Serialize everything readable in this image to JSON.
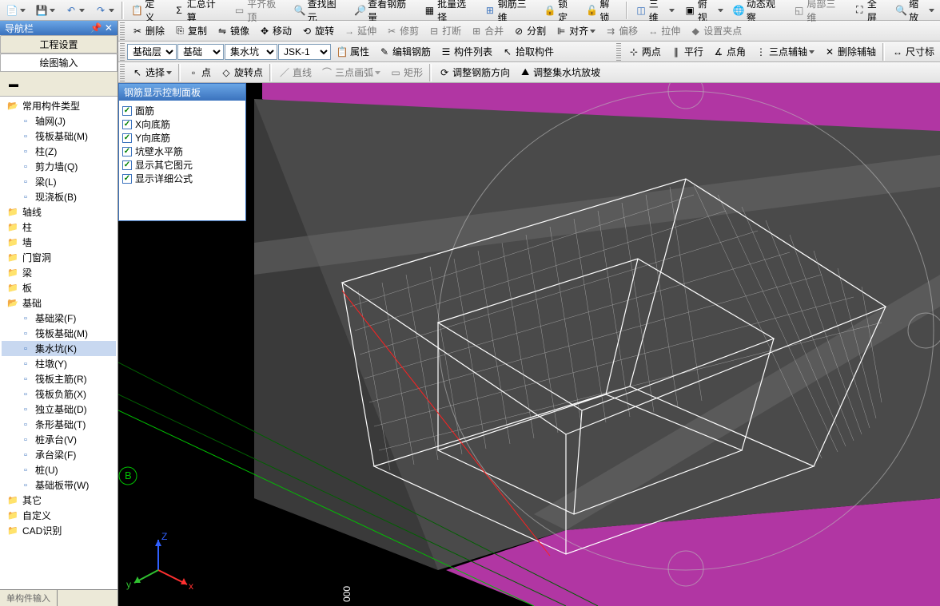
{
  "toolbar1": {
    "items": [
      "定义",
      "汇总计算",
      "平齐板顶",
      "查找图元",
      "查看钢筋量",
      "批量选择",
      "钢筋三维",
      "锁定",
      "解锁",
      "三维",
      "俯视",
      "动态观察",
      "局部三维",
      "全屏",
      "缩放"
    ]
  },
  "sidebar": {
    "title": "导航栏",
    "tabs": [
      "工程设置",
      "绘图输入"
    ],
    "activeTab": 1,
    "tree": [
      {
        "type": "folder",
        "label": "常用构件类型",
        "open": true,
        "indent": 0
      },
      {
        "type": "item",
        "label": "轴网(J)",
        "indent": 1,
        "icon": "grid"
      },
      {
        "type": "item",
        "label": "筏板基础(M)",
        "indent": 1,
        "icon": "slab"
      },
      {
        "type": "item",
        "label": "柱(Z)",
        "indent": 1,
        "icon": "col"
      },
      {
        "type": "item",
        "label": "剪力墙(Q)",
        "indent": 1,
        "icon": "wall"
      },
      {
        "type": "item",
        "label": "梁(L)",
        "indent": 1,
        "icon": "beam"
      },
      {
        "type": "item",
        "label": "现浇板(B)",
        "indent": 1,
        "icon": "plate"
      },
      {
        "type": "folder",
        "label": "轴线",
        "indent": 0
      },
      {
        "type": "folder",
        "label": "柱",
        "indent": 0
      },
      {
        "type": "folder",
        "label": "墙",
        "indent": 0
      },
      {
        "type": "folder",
        "label": "门窗洞",
        "indent": 0
      },
      {
        "type": "folder",
        "label": "梁",
        "indent": 0
      },
      {
        "type": "folder",
        "label": "板",
        "indent": 0
      },
      {
        "type": "folder",
        "label": "基础",
        "open": true,
        "indent": 0
      },
      {
        "type": "item",
        "label": "基础梁(F)",
        "indent": 1,
        "icon": "fb"
      },
      {
        "type": "item",
        "label": "筏板基础(M)",
        "indent": 1,
        "icon": "slab"
      },
      {
        "type": "item",
        "label": "集水坑(K)",
        "indent": 1,
        "icon": "pit",
        "selected": true
      },
      {
        "type": "item",
        "label": "柱墩(Y)",
        "indent": 1,
        "icon": "pier"
      },
      {
        "type": "item",
        "label": "筏板主筋(R)",
        "indent": 1,
        "icon": "rebar"
      },
      {
        "type": "item",
        "label": "筏板负筋(X)",
        "indent": 1,
        "icon": "rebar2"
      },
      {
        "type": "item",
        "label": "独立基础(D)",
        "indent": 1,
        "icon": "iso"
      },
      {
        "type": "item",
        "label": "条形基础(T)",
        "indent": 1,
        "icon": "strip"
      },
      {
        "type": "item",
        "label": "桩承台(V)",
        "indent": 1,
        "icon": "cap"
      },
      {
        "type": "item",
        "label": "承台梁(F)",
        "indent": 1,
        "icon": "capb"
      },
      {
        "type": "item",
        "label": "桩(U)",
        "indent": 1,
        "icon": "pile"
      },
      {
        "type": "item",
        "label": "基础板带(W)",
        "indent": 1,
        "icon": "band"
      },
      {
        "type": "folder",
        "label": "其它",
        "indent": 0
      },
      {
        "type": "folder",
        "label": "自定义",
        "indent": 0
      },
      {
        "type": "folder",
        "label": "CAD识别",
        "indent": 0
      }
    ]
  },
  "toolbar2": {
    "items": [
      "删除",
      "复制",
      "镜像",
      "移动",
      "旋转",
      "延伸",
      "修剪",
      "打断",
      "合并",
      "分割",
      "对齐",
      "偏移",
      "拉伸",
      "设置夹点"
    ]
  },
  "toolbar3": {
    "combo1": "基础层",
    "combo2": "基础",
    "combo3": "集水坑",
    "combo4": "JSK-1",
    "items": [
      "属性",
      "编辑钢筋",
      "构件列表",
      "拾取构件"
    ],
    "right": [
      "两点",
      "平行",
      "点角",
      "三点辅轴",
      "删除辅轴",
      "尺寸标"
    ]
  },
  "toolbar4": {
    "items": [
      "选择",
      "点",
      "旋转点",
      "直线",
      "三点画弧",
      "矩形",
      "调整钢筋方向",
      "调整集水坑放坡"
    ]
  },
  "floatPanel": {
    "title": "钢筋显示控制面板",
    "options": [
      {
        "label": "面筋",
        "checked": true
      },
      {
        "label": "X向底筋",
        "checked": true
      },
      {
        "label": "Y向底筋",
        "checked": true
      },
      {
        "label": "坑壁水平筋",
        "checked": true
      },
      {
        "label": "显示其它图元",
        "checked": true
      },
      {
        "label": "显示详细公式",
        "checked": true
      }
    ]
  },
  "coords": {
    "z": "Z",
    "x": "x",
    "y": "y"
  },
  "gridLabel": "B"
}
